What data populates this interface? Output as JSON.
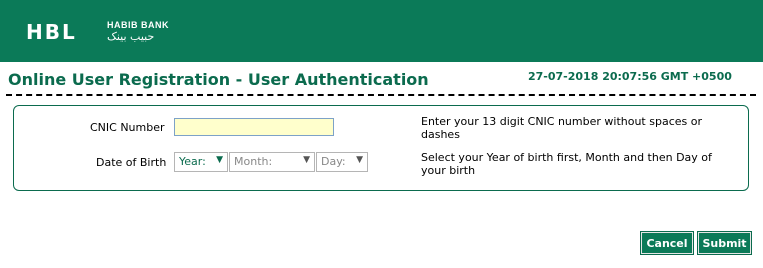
{
  "header": {
    "logo_text": "HBL",
    "bank_name": "HABIB BANK",
    "bank_name_urdu": "حبیب بینک"
  },
  "page": {
    "title": "Online User Registration - User Authentication",
    "timestamp": "27-07-2018 20:07:56 GMT +0500"
  },
  "form": {
    "cnic": {
      "label": "CNIC Number",
      "value": "",
      "help": "Enter your 13 digit CNIC number without spaces or dashes"
    },
    "dob": {
      "label": "Date of Birth",
      "year_selected": "Year:",
      "month_selected": "Month:",
      "day_selected": "Day:",
      "help": "Select your Year of birth first, Month and then Day of your birth"
    }
  },
  "buttons": {
    "cancel": "Cancel",
    "submit": "Submit"
  },
  "colors": {
    "brand_green": "#0b7a58",
    "input_highlight": "#ffffcc"
  }
}
